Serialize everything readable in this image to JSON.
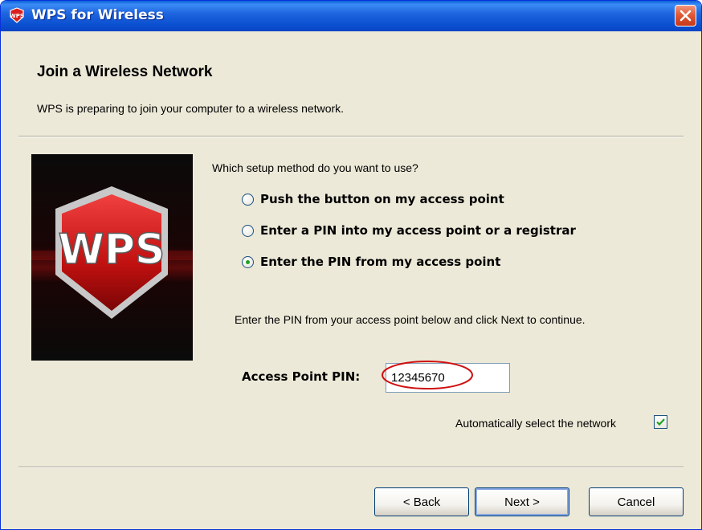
{
  "window": {
    "title": "WPS for Wireless"
  },
  "header": {
    "title": "Join a Wireless Network",
    "subtitle": "WPS is preparing to join your computer to a wireless network."
  },
  "logo": {
    "text": "WPS"
  },
  "setup": {
    "question": "Which setup method do you want to use?",
    "options": [
      {
        "label": "Push the button on my access point",
        "selected": false
      },
      {
        "label": "Enter a PIN into my access point or a registrar",
        "selected": false
      },
      {
        "label": "Enter the PIN from my access point",
        "selected": true
      }
    ],
    "instruction": "Enter the PIN from your access point below and click Next to continue.",
    "pin_label": "Access Point PIN:",
    "pin_value": "12345670",
    "auto_select_label": "Automatically select the network",
    "auto_select_checked": true
  },
  "buttons": {
    "back": "< Back",
    "next": "Next >",
    "cancel": "Cancel"
  },
  "colors": {
    "titlebar": "#0a4fd0",
    "dialog_bg": "#ece9d8",
    "highlight_circle": "#d01010",
    "radio_selected": "#21a121"
  }
}
